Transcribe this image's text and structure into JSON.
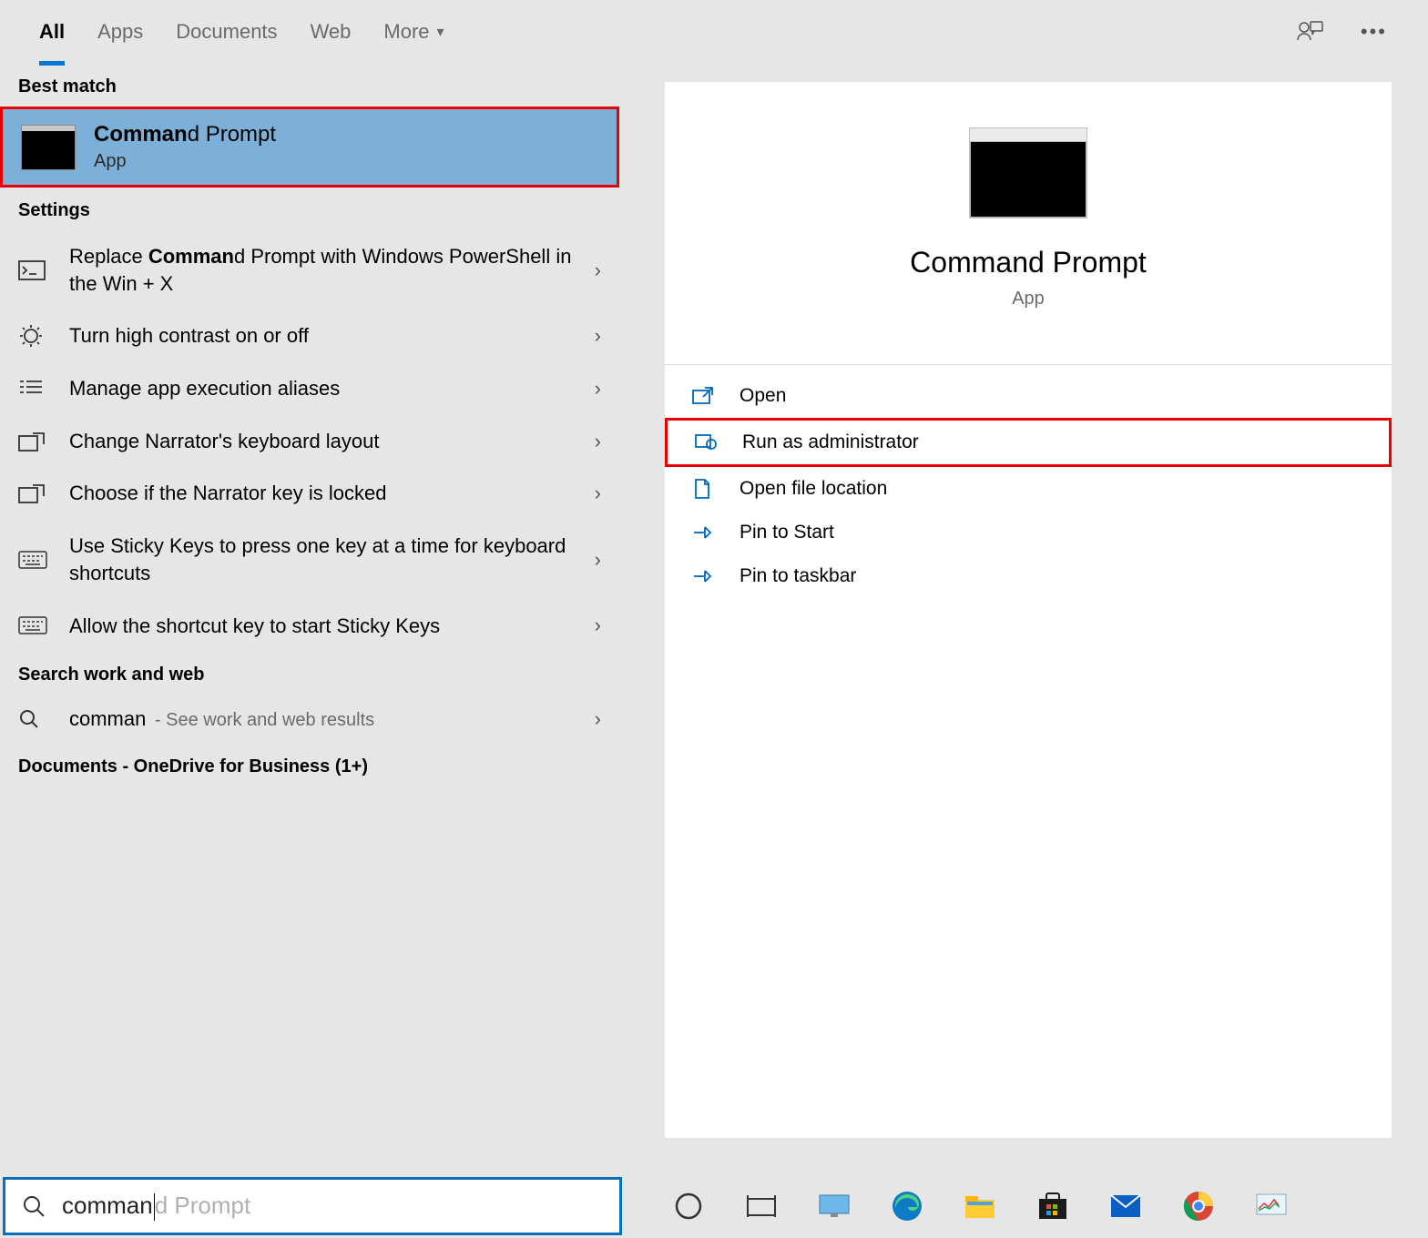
{
  "tabs": {
    "all": "All",
    "apps": "Apps",
    "documents": "Documents",
    "web": "Web",
    "more": "More"
  },
  "sections": {
    "best_match": "Best match",
    "settings": "Settings",
    "search_web": "Search work and web",
    "documents_onedrive": "Documents - OneDrive for Business (1+)"
  },
  "best_match": {
    "title_bold": "Comman",
    "title_rest": "d Prompt",
    "sub": "App"
  },
  "settings_items": [
    {
      "icon": "console",
      "pre": "Replace ",
      "bold": "Comman",
      "post": "d Prompt with Windows PowerShell in the Win + X"
    },
    {
      "icon": "contrast",
      "pre": "Turn high contrast on or off",
      "bold": "",
      "post": ""
    },
    {
      "icon": "aliases",
      "pre": "Manage app execution aliases",
      "bold": "",
      "post": ""
    },
    {
      "icon": "narrator",
      "pre": "Change Narrator's keyboard layout",
      "bold": "",
      "post": ""
    },
    {
      "icon": "narrator",
      "pre": "Choose if the Narrator key is locked",
      "bold": "",
      "post": ""
    },
    {
      "icon": "keyboard",
      "pre": "Use Sticky Keys to press one key at a time for keyboard shortcuts",
      "bold": "",
      "post": ""
    },
    {
      "icon": "keyboard",
      "pre": "Allow the shortcut key to start Sticky Keys",
      "bold": "",
      "post": ""
    }
  ],
  "web_item": {
    "query": "comman",
    "hint": " - See work and web results"
  },
  "preview": {
    "title": "Command Prompt",
    "sub": "App"
  },
  "actions": {
    "open": "Open",
    "run_admin": "Run as administrator",
    "open_location": "Open file location",
    "pin_start": "Pin to Start",
    "pin_taskbar": "Pin to taskbar"
  },
  "search": {
    "typed": "comman",
    "ghost": "d Prompt"
  }
}
